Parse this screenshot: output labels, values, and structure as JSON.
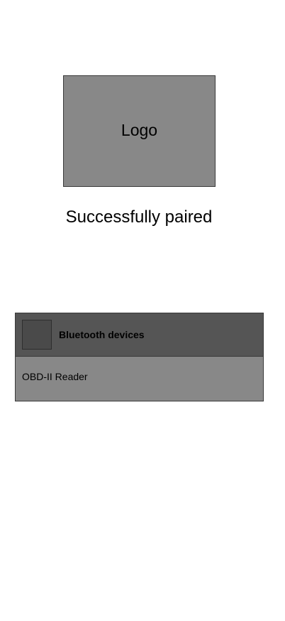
{
  "logo": {
    "label": "Logo"
  },
  "status": {
    "message": "Successfully paired"
  },
  "bluetooth_panel": {
    "title": "Bluetooth devices",
    "icon": "bluetooth-icon",
    "devices": [
      {
        "name": "OBD-II Reader"
      }
    ]
  },
  "colors": {
    "placeholder_gray": "#888888",
    "header_gray": "#555555",
    "icon_gray": "#4a4a4a",
    "border": "#3a3a3a"
  }
}
